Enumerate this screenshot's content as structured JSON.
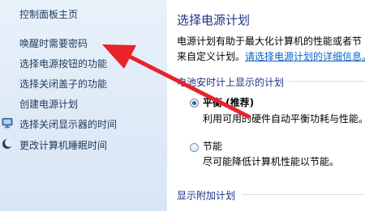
{
  "sidebar": {
    "items": [
      {
        "label": "控制面板主页",
        "icon": null
      },
      {
        "label": "唤醒时需要密码",
        "icon": null
      },
      {
        "label": "选择电源按钮的功能",
        "icon": null
      },
      {
        "label": "选择关闭盖子的功能",
        "icon": null
      },
      {
        "label": "创建电源计划",
        "icon": null
      },
      {
        "label": "选择关闭显示器的时间",
        "icon": "monitor-icon"
      },
      {
        "label": "更改计算机睡眠时间",
        "icon": "moon-icon"
      }
    ]
  },
  "main": {
    "title": "选择电源计划",
    "description_line1": "电源计划有助于最大化计算机的性能或者节",
    "description_line2_prefix": "来自定义计划。",
    "description_link": "请选择电源计划的详细信息。",
    "battery_section_title": "电池安时计上显示的计划",
    "plans": [
      {
        "name": "平衡 (推荐)",
        "description": "利用可用的硬件自动平衡功耗与性能。",
        "selected": true
      },
      {
        "name": "节能",
        "description": "尽可能降低计算机性能以节能。",
        "selected": false
      }
    ],
    "additional_section_title": "显示附加计划"
  },
  "annotation": {
    "arrow_color": "#e8232a"
  }
}
